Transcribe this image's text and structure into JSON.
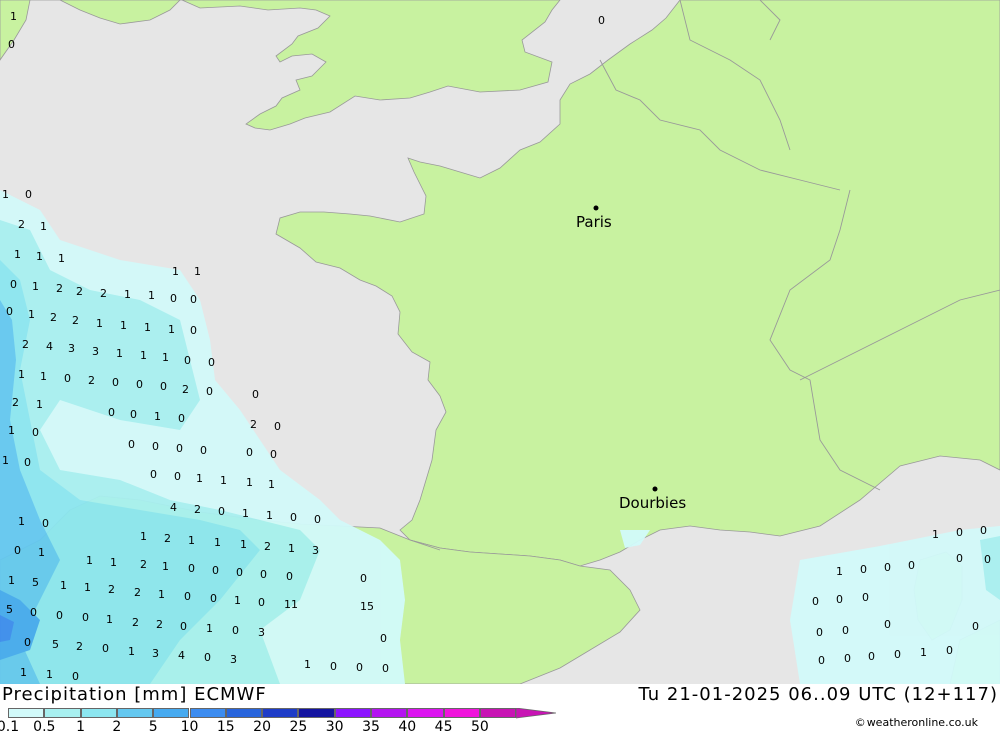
{
  "title": "Precipitation [mm] ECMWF",
  "datetime": "Tu 21-01-2025 06..09 UTC (12+117)",
  "credit": "weatheronline.co.uk",
  "credit_symbol": "©",
  "colors": {
    "sea": "#e6e6e6",
    "land": "#c8f2a0",
    "border": "#999999"
  },
  "cities": [
    {
      "name": "Paris"
    },
    {
      "name": "Dourbies"
    }
  ],
  "legend": {
    "labels": [
      "0.1",
      "0.5",
      "1",
      "2",
      "5",
      "10",
      "15",
      "20",
      "25",
      "30",
      "35",
      "40",
      "45",
      "50"
    ],
    "colors": [
      "#d2fafa",
      "#a8f0f0",
      "#8ce6f0",
      "#64c8f0",
      "#46aaf0",
      "#3c8cf0",
      "#2864dc",
      "#1e3cc8",
      "#1414a0",
      "#8c14ff",
      "#b414f0",
      "#dc14f0",
      "#f014dc",
      "#c814b4"
    ]
  },
  "values": [
    "1",
    "0",
    "1",
    "0",
    "2",
    "1",
    "1",
    "1",
    "1",
    "0",
    "1",
    "2",
    "2",
    "2",
    "1",
    "1",
    "0",
    "0",
    "1",
    "1",
    "0",
    "1",
    "2",
    "2",
    "1",
    "1",
    "1",
    "1",
    "0",
    "2",
    "4",
    "3",
    "3",
    "1",
    "1",
    "1",
    "0",
    "0",
    "1",
    "1",
    "0",
    "2",
    "0",
    "0",
    "0",
    "2",
    "0",
    "2",
    "1",
    "0",
    "0",
    "0",
    "1",
    "0",
    "2",
    "0",
    "1",
    "0",
    "0",
    "0",
    "0",
    "0",
    "0",
    "0",
    "1",
    "0",
    "0",
    "0",
    "1",
    "1",
    "1",
    "1",
    "4",
    "2",
    "0",
    "1",
    "1",
    "0",
    "0",
    "1",
    "0",
    "1",
    "2",
    "1",
    "1",
    "1",
    "2",
    "1",
    "3",
    "0",
    "1",
    "1",
    "1",
    "2",
    "1",
    "0",
    "0",
    "0",
    "0",
    "0",
    "0",
    "1",
    "5",
    "1",
    "1",
    "2",
    "2",
    "1",
    "0",
    "0",
    "1",
    "0",
    "11",
    "15",
    "5",
    "0",
    "0",
    "0",
    "1",
    "2",
    "2",
    "0",
    "1",
    "0",
    "3",
    "0",
    "0",
    "5",
    "2",
    "0",
    "1",
    "3",
    "4",
    "0",
    "3",
    "1",
    "1",
    "0",
    "1",
    "0",
    "0",
    "0",
    "0",
    "1",
    "0",
    "0",
    "0",
    "1",
    "0",
    "0",
    "0",
    "0",
    "0",
    "0",
    "0",
    "0",
    "0",
    "0",
    "0",
    "0",
    "1",
    "0",
    "0",
    "0",
    "0",
    "0",
    "1",
    "0",
    "0",
    "1"
  ]
}
